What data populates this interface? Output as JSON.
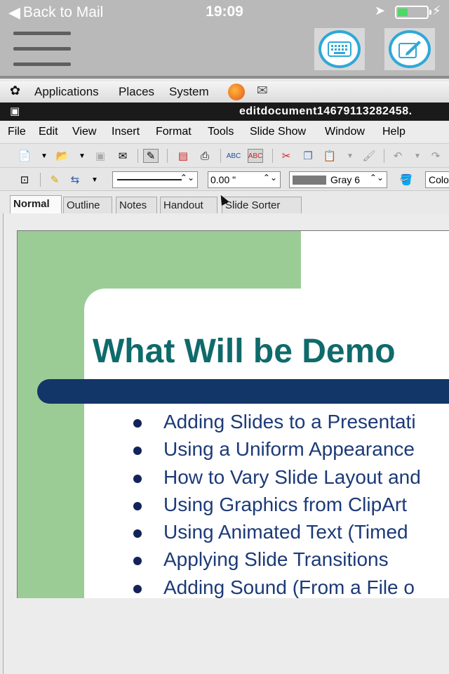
{
  "status": {
    "back_label": "Back to Mail",
    "time": "19:09"
  },
  "colors": {
    "accent": "#2fa8d8",
    "slide_green": "#9ccc96",
    "slide_title": "#0f6a6b",
    "slide_bar": "#123668"
  },
  "desktop_panel": {
    "items": [
      "Applications",
      "Places",
      "System"
    ]
  },
  "window": {
    "title": "editdocument14679113282458."
  },
  "menu": [
    "File",
    "Edit",
    "View",
    "Insert",
    "Format",
    "Tools",
    "Slide Show",
    "Window",
    "Help"
  ],
  "line_width": "0.00 \"",
  "line_color": "Gray 6",
  "color_field": "Colo",
  "view_tabs": [
    "Normal",
    "Outline",
    "Notes",
    "Handout",
    "Slide Sorter"
  ],
  "slide": {
    "title": "What Will be Demo",
    "bullets": [
      "Adding Slides to a Presentati",
      "Using a Uniform Appearance",
      "How to Vary Slide Layout and",
      "Using Graphics from ClipArt",
      "Using Animated Text (Timed",
      "Applying Slide Transitions",
      "Adding Sound (From a File o"
    ]
  }
}
